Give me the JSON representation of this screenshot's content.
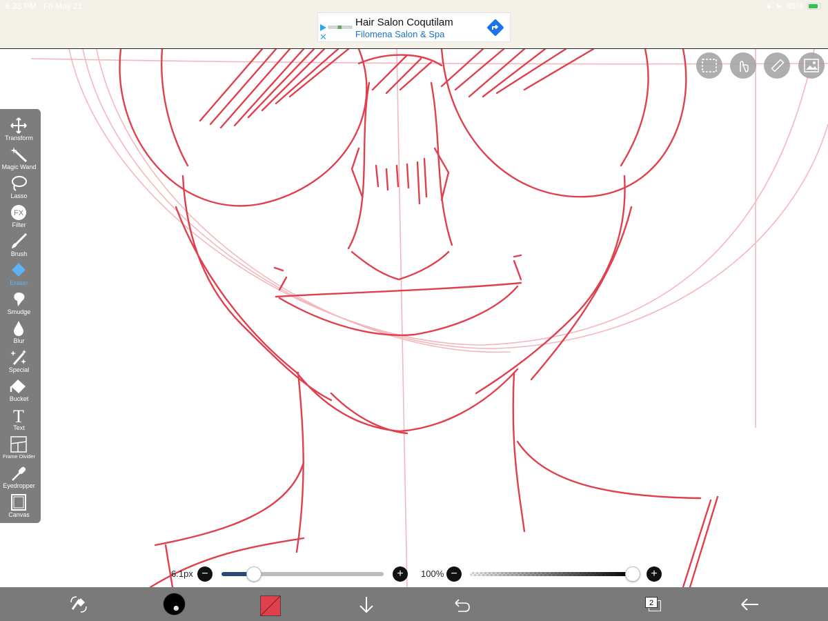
{
  "status": {
    "time": "6:23 PM",
    "date": "Fri May 21",
    "battery": "85%"
  },
  "ad": {
    "title": "Hair Salon Coqutilam",
    "subtitle": "Filomena Salon & Spa"
  },
  "toolbar": {
    "tools": [
      {
        "label": "Transform",
        "icon": "move-arrows-icon"
      },
      {
        "label": "Magic Wand",
        "icon": "magic-wand-icon"
      },
      {
        "label": "Lasso",
        "icon": "lasso-icon"
      },
      {
        "label": "Filter",
        "icon": "fx-icon"
      },
      {
        "label": "Brush",
        "icon": "brush-icon"
      },
      {
        "label": "Eraser",
        "icon": "eraser-icon",
        "active": true
      },
      {
        "label": "Smudge",
        "icon": "smudge-icon"
      },
      {
        "label": "Blur",
        "icon": "droplet-icon"
      },
      {
        "label": "Special",
        "icon": "sparkle-icon"
      },
      {
        "label": "Bucket",
        "icon": "bucket-icon"
      },
      {
        "label": "Text",
        "icon": "text-icon"
      },
      {
        "label": "Frame Divider",
        "icon": "frame-divider-icon"
      },
      {
        "label": "Eyedropper",
        "icon": "eyedropper-icon"
      },
      {
        "label": "Canvas",
        "icon": "canvas-icon"
      }
    ],
    "fx_glyph": "FX",
    "text_glyph": "T"
  },
  "brush_size": {
    "label": "6.1px",
    "fraction": 0.2
  },
  "opacity": {
    "label": "100%",
    "fraction": 1.0
  },
  "slider_buttons": {
    "minus": "−",
    "plus": "+"
  },
  "layers": {
    "count": "2"
  },
  "colors": {
    "stroke": "#e0404e",
    "accent": "#5fb3f2",
    "toolbar": "#7d7d7d"
  }
}
